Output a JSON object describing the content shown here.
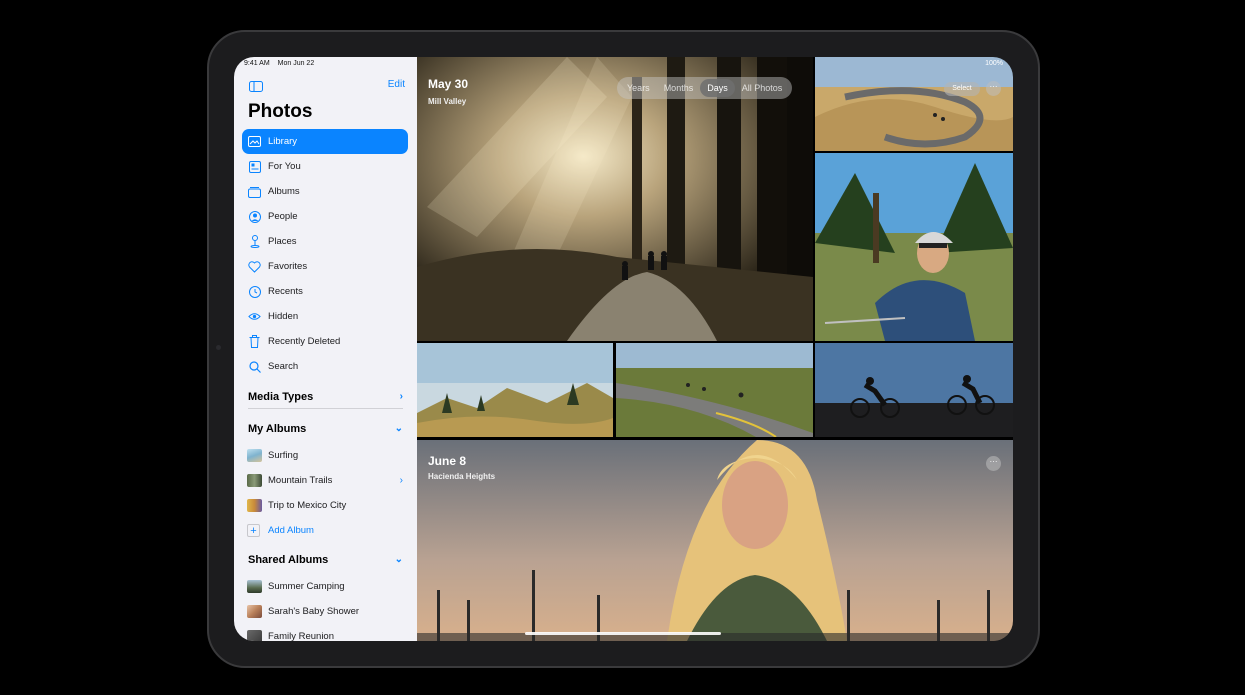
{
  "status": {
    "time": "9:41 AM",
    "date": "Mon Jun 22",
    "battery": "100%"
  },
  "sidebar": {
    "edit_label": "Edit",
    "title": "Photos",
    "nav": [
      {
        "label": "Library",
        "icon": "library-icon",
        "active": true
      },
      {
        "label": "For You",
        "icon": "for-you-icon"
      },
      {
        "label": "Albums",
        "icon": "albums-icon"
      },
      {
        "label": "People",
        "icon": "people-icon"
      },
      {
        "label": "Places",
        "icon": "places-icon"
      },
      {
        "label": "Favorites",
        "icon": "heart-icon"
      },
      {
        "label": "Recents",
        "icon": "clock-icon"
      },
      {
        "label": "Hidden",
        "icon": "eye-icon"
      },
      {
        "label": "Recently Deleted",
        "icon": "trash-icon"
      },
      {
        "label": "Search",
        "icon": "search-icon"
      }
    ],
    "media_types_label": "Media Types",
    "my_albums_label": "My Albums",
    "my_albums": [
      {
        "label": "Surfing"
      },
      {
        "label": "Mountain Trails"
      },
      {
        "label": "Trip to Mexico City"
      }
    ],
    "add_album_label": "Add Album",
    "shared_albums_label": "Shared Albums",
    "shared_albums": [
      {
        "label": "Summer Camping"
      },
      {
        "label": "Sarah's Baby Shower"
      },
      {
        "label": "Family Reunion"
      }
    ]
  },
  "view_modes": [
    "Years",
    "Months",
    "Days",
    "All Photos"
  ],
  "active_view_mode": "Days",
  "select_label": "Select",
  "sections": [
    {
      "date": "May 30",
      "location": "Mill Valley"
    },
    {
      "date": "June 8",
      "location": "Hacienda Heights"
    }
  ],
  "colors": {
    "accent": "#0a84ff",
    "sidebar_bg": "#f2f2f7"
  }
}
